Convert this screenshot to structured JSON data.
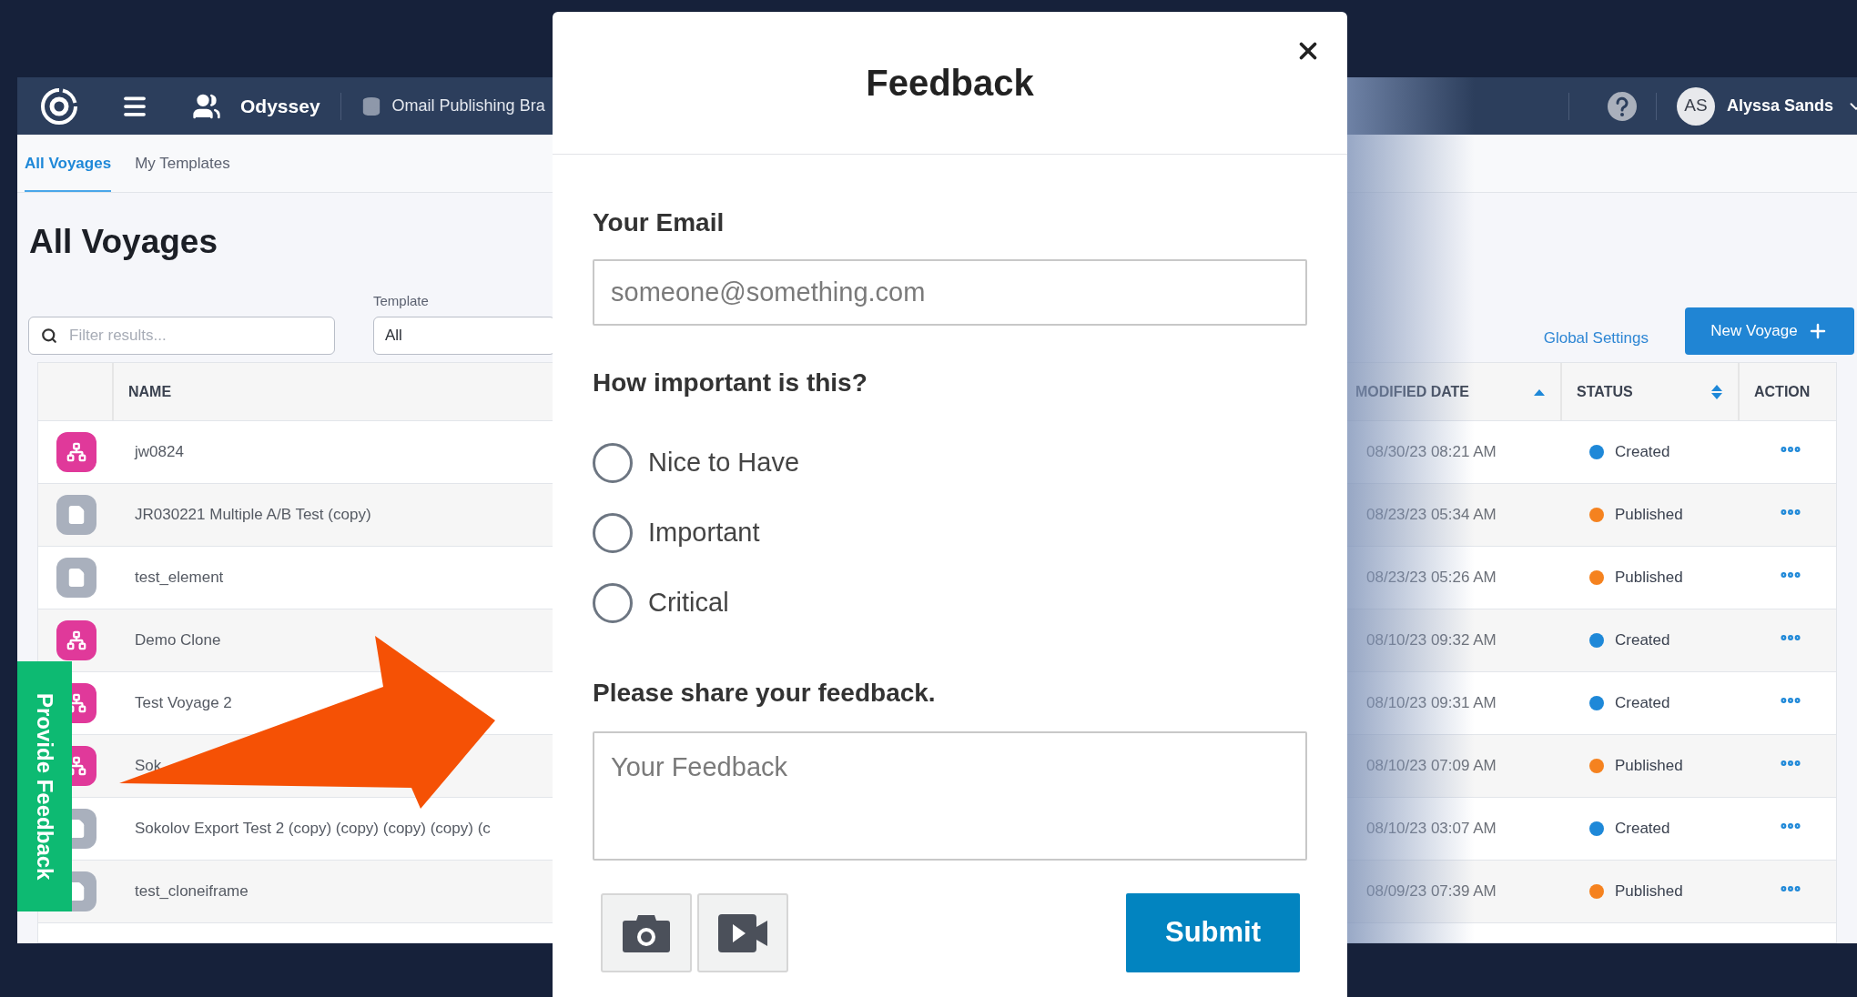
{
  "header": {
    "app_name": "Odyssey",
    "workspace": "Omail Publishing Bra",
    "user": {
      "initials": "AS",
      "name": "Alyssa Sands"
    }
  },
  "tabs": [
    {
      "label": "All Voyages",
      "selected": true
    },
    {
      "label": "My Templates",
      "selected": false
    }
  ],
  "page_title": "All Voyages",
  "filter": {
    "placeholder": "Filter results..."
  },
  "template_select": {
    "label": "Template",
    "value": "All"
  },
  "global_settings_link": "Global Settings",
  "new_voyage_button": "New Voyage",
  "table": {
    "columns": [
      {
        "label": "NAME",
        "kind": "plain"
      },
      {
        "label": "MODIFIED DATE",
        "kind": "sorted_ascending"
      },
      {
        "label": "STATUS",
        "kind": "sortable"
      },
      {
        "label": "ACTION",
        "kind": "plain"
      }
    ],
    "rows": [
      {
        "kind": "flow",
        "name": "jw0824",
        "modified": "08/30/23 08:21 AM",
        "status": "Created",
        "color": "#1e88d8"
      },
      {
        "kind": "page",
        "name": "JR030221 Multiple A/B Test (copy)",
        "modified": "08/23/23 05:34 AM",
        "status": "Published",
        "color": "#f5821f"
      },
      {
        "kind": "page",
        "name": "test_element",
        "modified": "08/23/23 05:26 AM",
        "status": "Published",
        "color": "#f5821f"
      },
      {
        "kind": "flow",
        "name": "Demo Clone",
        "modified": "08/10/23 09:32 AM",
        "status": "Created",
        "color": "#1e88d8"
      },
      {
        "kind": "flow",
        "name": "Test Voyage 2",
        "modified": "08/10/23 09:31 AM",
        "status": "Created",
        "color": "#1e88d8"
      },
      {
        "kind": "flow",
        "name": "Sok",
        "modified": "08/10/23 07:09 AM",
        "status": "Published",
        "color": "#f5821f"
      },
      {
        "kind": "page",
        "name": "Sokolov Export Test 2 (copy) (copy) (copy) (copy) (c",
        "modified": "08/10/23 03:07 AM",
        "status": "Created",
        "color": "#1e88d8"
      },
      {
        "kind": "page",
        "name": "test_cloneiframe",
        "modified": "08/09/23 07:39 AM",
        "status": "Published",
        "color": "#f5821f"
      }
    ]
  },
  "feedback_tab": "Provide Feedback",
  "feedback_dialog": {
    "title": "Feedback",
    "email": {
      "label": "Your Email",
      "placeholder": "someone@something.com"
    },
    "importance": {
      "question": "How important is this?",
      "options": [
        {
          "label": "Nice to Have",
          "selected": false
        },
        {
          "label": "Important",
          "selected": false
        },
        {
          "label": "Critical",
          "selected": false
        }
      ]
    },
    "feedback": {
      "label": "Please share your feedback.",
      "placeholder": "Your Feedback"
    },
    "submit": "Submit"
  }
}
